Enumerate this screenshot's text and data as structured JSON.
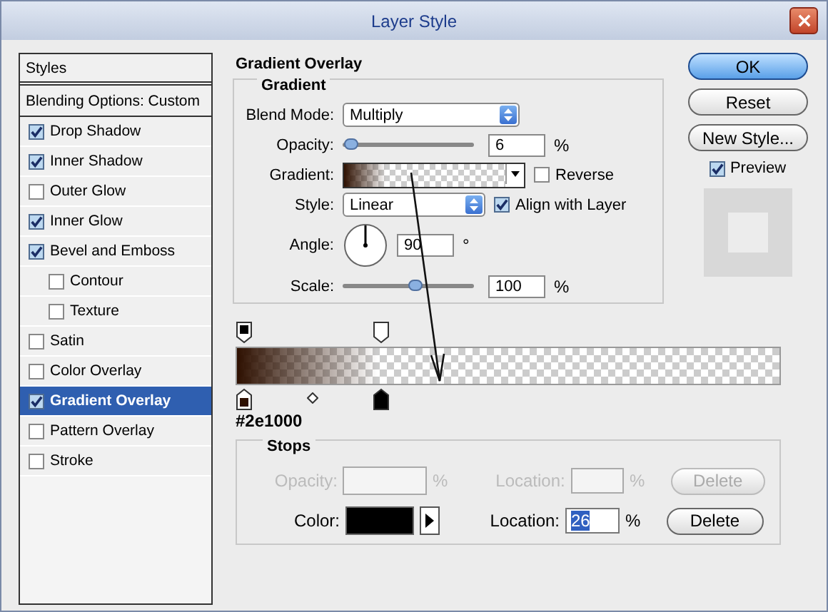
{
  "window": {
    "title": "Layer Style"
  },
  "styles_list": [
    {
      "kind": "header",
      "label": "Styles"
    },
    {
      "kind": "option",
      "label": "Blending Options: Custom",
      "selected": false
    },
    {
      "kind": "effect",
      "label": "Drop Shadow",
      "checked": true,
      "selected": false
    },
    {
      "kind": "effect",
      "label": "Inner Shadow",
      "checked": true,
      "selected": false
    },
    {
      "kind": "effect",
      "label": "Outer Glow",
      "checked": false,
      "selected": false
    },
    {
      "kind": "effect",
      "label": "Inner Glow",
      "checked": true,
      "selected": false
    },
    {
      "kind": "effect",
      "label": "Bevel and Emboss",
      "checked": true,
      "selected": false,
      "children": [
        {
          "kind": "effect",
          "label": "Contour",
          "checked": false,
          "selected": false
        },
        {
          "kind": "effect",
          "label": "Texture",
          "checked": false,
          "selected": false
        }
      ]
    },
    {
      "kind": "effect",
      "label": "Satin",
      "checked": false,
      "selected": false
    },
    {
      "kind": "effect",
      "label": "Color Overlay",
      "checked": false,
      "selected": false
    },
    {
      "kind": "effect",
      "label": "Gradient Overlay",
      "checked": true,
      "selected": true
    },
    {
      "kind": "effect",
      "label": "Pattern Overlay",
      "checked": false,
      "selected": false
    },
    {
      "kind": "effect",
      "label": "Stroke",
      "checked": false,
      "selected": false
    }
  ],
  "panel": {
    "title": "Gradient Overlay",
    "group": "Gradient",
    "blend_mode": {
      "label": "Blend Mode:",
      "value": "Multiply"
    },
    "opacity": {
      "label": "Opacity:",
      "level": 0.06,
      "value": "6",
      "unit": "%"
    },
    "gradient": {
      "label": "Gradient:",
      "reverse": {
        "label": "Reverse",
        "checked": false
      }
    },
    "style": {
      "label": "Style:",
      "value": "Linear",
      "align": {
        "label": "Align with Layer",
        "checked": true
      }
    },
    "angle": {
      "label": "Angle:",
      "value": "90",
      "unit": "°"
    },
    "scale": {
      "label": "Scale:",
      "level": 0.55,
      "value": "100",
      "unit": "%"
    }
  },
  "buttons": [
    {
      "label": "OK",
      "default": true
    },
    {
      "label": "Reset",
      "default": false
    },
    {
      "label": "New Style...",
      "default": false
    }
  ],
  "preview": {
    "label": "Preview",
    "checked": true
  },
  "gradient_editor": {
    "opacity_stops": [
      {
        "selected": false,
        "color": "#000000"
      },
      {
        "selected": false,
        "color": "#ffffff"
      }
    ],
    "color_stops": [
      {
        "selected": false,
        "color": "#2e1000"
      },
      {
        "selected": true,
        "color": "#000000"
      }
    ],
    "color_code": "#2e1000",
    "stops": {
      "title": "Stops",
      "opacity": {
        "label": "Opacity:",
        "unit": "%",
        "disabled": true
      },
      "opacity_location": {
        "label": "Location:",
        "unit": "%",
        "disabled": true
      },
      "opacity_delete": {
        "label": "Delete",
        "disabled": true
      },
      "color": {
        "label": "Color:",
        "color": "#000000"
      },
      "color_location": {
        "label": "Location:",
        "value": "26",
        "unit": "%",
        "disabled": false
      },
      "color_delete": {
        "label": "Delete",
        "disabled": false
      }
    }
  }
}
